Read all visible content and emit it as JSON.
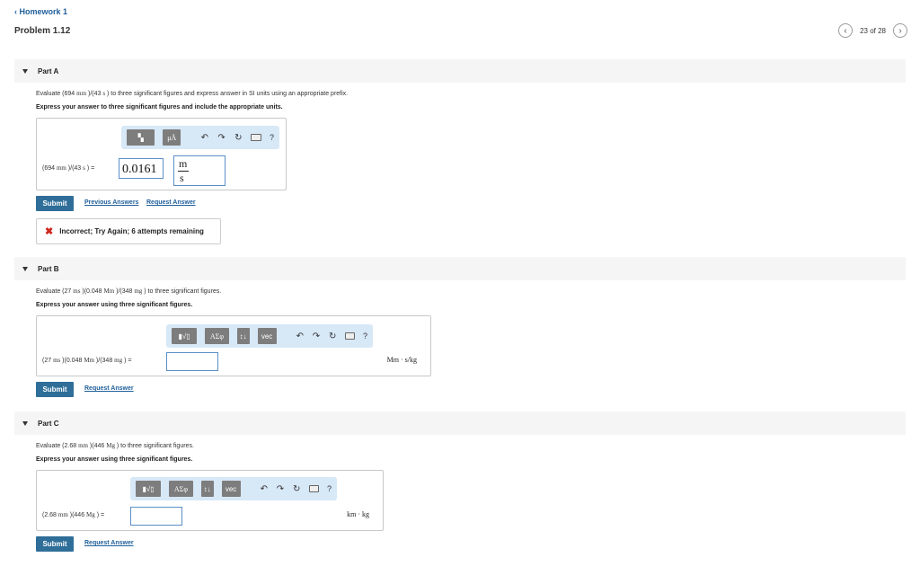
{
  "header": {
    "back_label": "Homework 1",
    "problem_title": "Problem 1.12",
    "pager": "23 of 28"
  },
  "icons": {
    "back": "chevron-left-icon",
    "prev": "chevron-left-icon",
    "next": "chevron-right-icon",
    "undo": "undo-icon",
    "redo": "redo-icon",
    "reset": "reset-icon",
    "keyboard": "keyboard-icon",
    "help": "help-icon"
  },
  "colors": {
    "submit": "#2f6e98",
    "link": "#1f5f9a",
    "toolbar_bg": "#d7e8f7",
    "incorrect": "#d0271d"
  },
  "part_a": {
    "title": "Part A",
    "prompt_pre": "Evaluate (694 ",
    "prompt_u1": "mm",
    "prompt_mid": " )/(43 ",
    "prompt_u2": "s",
    "prompt_post": " ) to three significant figures and express answer in SI units using an appropriate prefix.",
    "instruction": "Express your answer to three significant figures and include the appropriate units.",
    "toolbar": {
      "templates": "▚",
      "units": "μÅ",
      "help": "?"
    },
    "expr_pre": "(694 ",
    "expr_u1": "mm",
    "expr_mid": " )/(43 ",
    "expr_u2": "s",
    "expr_post": " ) =",
    "value": "0.0161",
    "unit_num": "m",
    "unit_den": "s",
    "submit_label": "Submit",
    "previous_answers_label": "Previous Answers",
    "request_answer_label": "Request Answer",
    "feedback": "Incorrect; Try Again; 6 attempts remaining"
  },
  "part_b": {
    "title": "Part B",
    "prompt_pre": "Evaluate (27 ",
    "prompt_u1": "ms",
    "prompt_mid1": " )(0.048 ",
    "prompt_u2": "Mm",
    "prompt_mid2": " )/(348 ",
    "prompt_u3": "mg",
    "prompt_post": " ) to three significant figures.",
    "instruction": "Express your answer using three significant figures.",
    "toolbar": {
      "sqrt": "▮√▯",
      "greek": "ΑΣφ",
      "arrows": "↕↓",
      "vec": "vec",
      "help": "?"
    },
    "expr_pre": "(27 ",
    "expr_u1": "ms",
    "expr_mid1": " )(0.048 ",
    "expr_u2": "Mm",
    "expr_mid2": " )/(348 ",
    "expr_u3": "mg",
    "expr_post": " ) =",
    "unit": "Mm · s/kg",
    "submit_label": "Submit",
    "request_answer_label": "Request Answer"
  },
  "part_c": {
    "title": "Part C",
    "prompt_pre": "Evaluate (2.68 ",
    "prompt_u1": "mm",
    "prompt_mid": " )(446 ",
    "prompt_u2": "Mg",
    "prompt_post": " ) to three significant figures.",
    "instruction": "Express your answer using three significant figures.",
    "toolbar": {
      "sqrt": "▮√▯",
      "greek": "ΑΣφ",
      "arrows": "↕↓",
      "vec": "vec",
      "help": "?"
    },
    "expr_pre": "(2.68 ",
    "expr_u1": "mm",
    "expr_mid": " )(446 ",
    "expr_u2": "Mg",
    "expr_post": " ) =",
    "unit": "km · kg",
    "submit_label": "Submit",
    "request_answer_label": "Request Answer"
  }
}
